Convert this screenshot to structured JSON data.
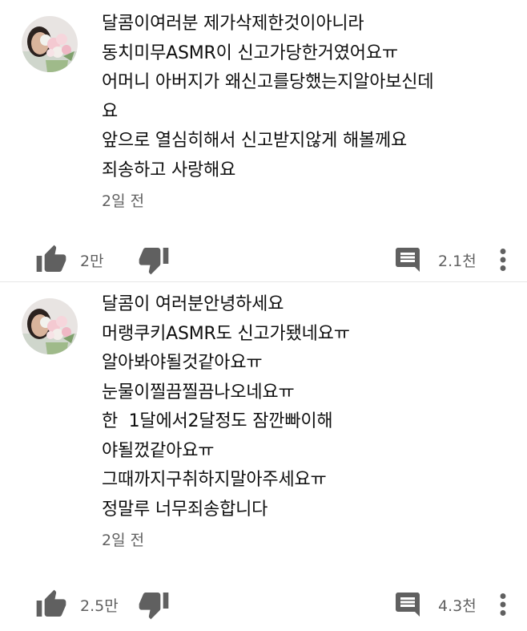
{
  "comments": [
    {
      "lines": [
        "달콤이여러분 제가삭제한것이아니라",
        "동치미무ASMR이 신고가당한거였어요ㅠ",
        "어머니 아버지가 왜신고를당했는지알아보신데",
        "요",
        "앞으로 열심히해서 신고받지않게 해볼께요",
        "죄송하고 사랑해요"
      ],
      "time": "2일 전",
      "likes": "2만",
      "replies": "2.1천",
      "avatar_icon": "profile-photo-flowers"
    },
    {
      "lines": [
        "달콤이 여러분안녕하세요",
        "머랭쿠키ASMR도 신고가됐네요ㅠ",
        "알아봐야될것같아요ㅠ",
        "눈물이찔끔찔끔나오네요ㅠ",
        "한  1달에서2달정도 잠깐빠이해",
        "야될껐같아요ㅠ",
        "그때까지구취하지말아주세요ㅠ",
        "정말루 너무죄송합니다"
      ],
      "time": "2일 전",
      "likes": "2.5만",
      "replies": "4.3천",
      "avatar_icon": "profile-photo-flowers"
    }
  ],
  "icons": {
    "like": "thumbs-up-icon",
    "dislike": "thumbs-down-icon",
    "reply": "comment-icon",
    "more": "more-vert-icon"
  },
  "colors": {
    "text": "#0f0f0f",
    "secondary": "#606060",
    "icon": "#606060",
    "background": "#ffffff"
  }
}
